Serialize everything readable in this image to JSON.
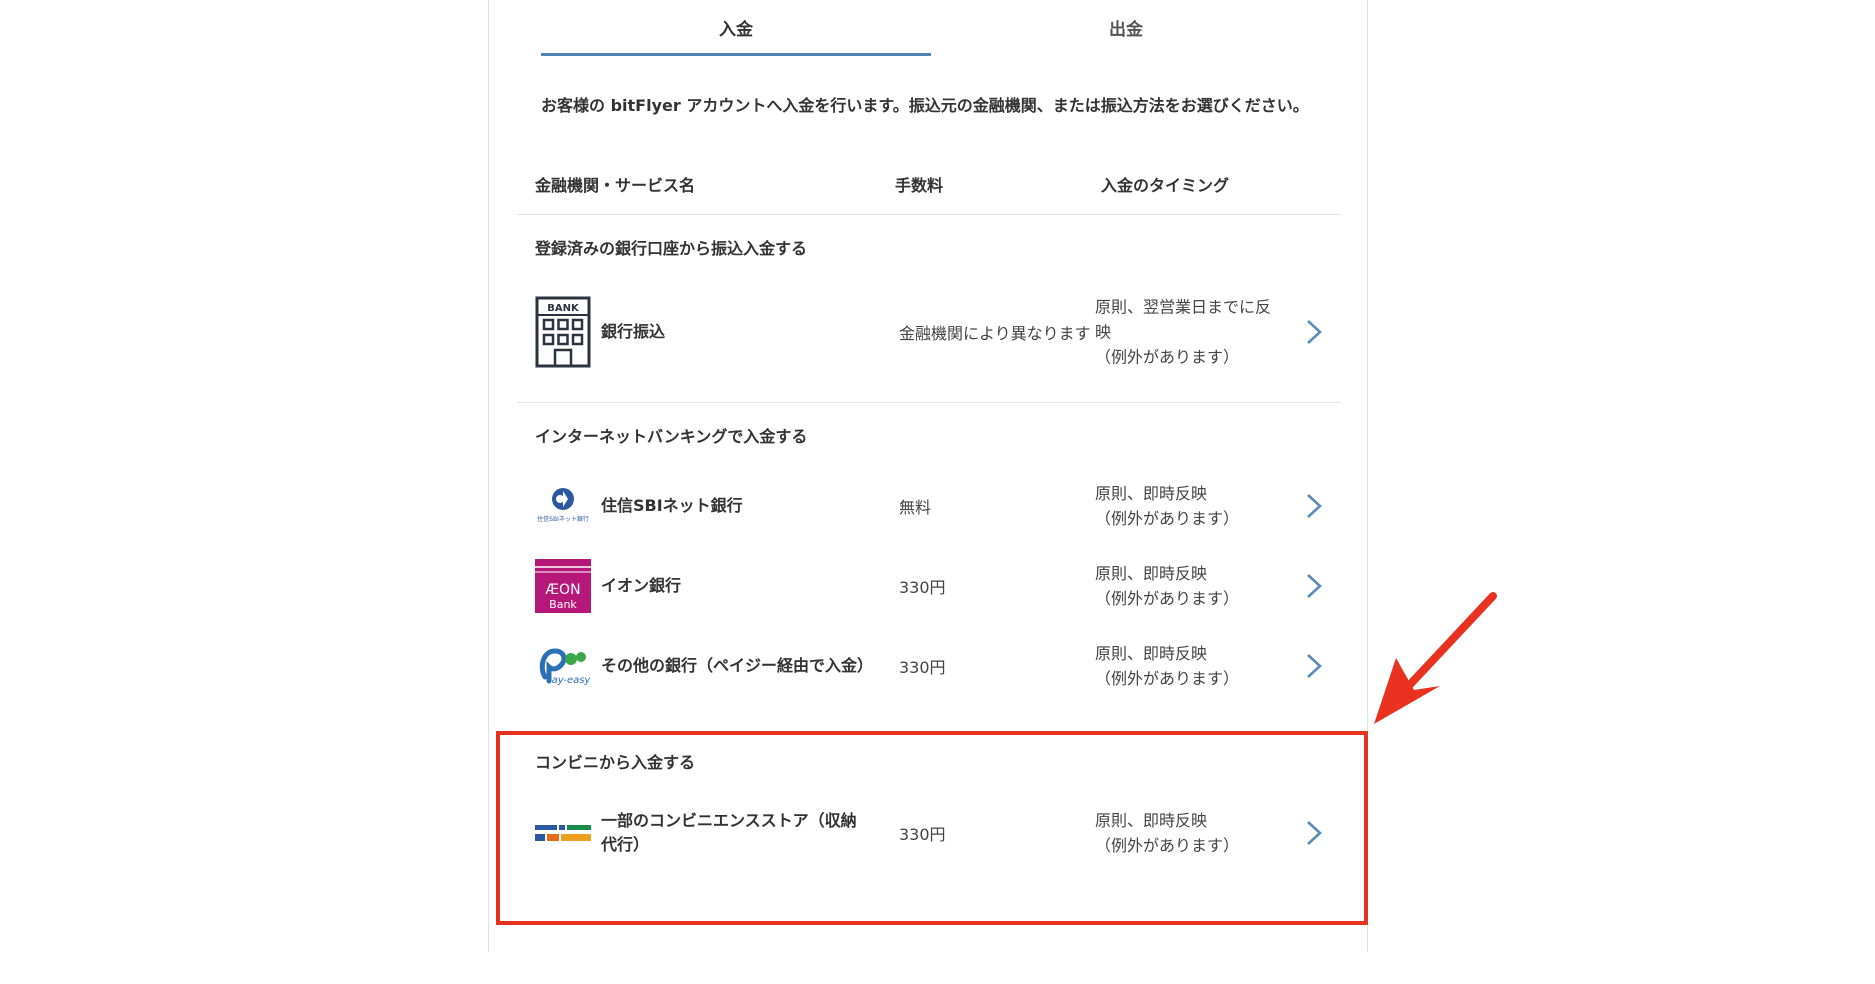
{
  "tabs": [
    {
      "label": "入金",
      "active": true
    },
    {
      "label": "出金",
      "active": false
    }
  ],
  "intro": "お客様の bitFlyer アカウントへ入金を行います。振込元の金融機関、または振込方法をお選びください。",
  "columns": {
    "name": "金融機関・サービス名",
    "fee": "手数料",
    "timing": "入金のタイミング"
  },
  "sections": [
    {
      "title": "登録済みの銀行口座から振込入金する",
      "rows": [
        {
          "name": "銀行振込",
          "fee": "金融機関により異なります",
          "timing": "原則、翌営業日までに反映",
          "note": "（例外があります）",
          "icon": "bank-icon",
          "logo_text": "BANK"
        }
      ]
    },
    {
      "title": "インターネットバンキングで入金する",
      "rows": [
        {
          "name": "住信SBIネット銀行",
          "fee": "無料",
          "timing": "原則、即時反映",
          "note": "（例外があります）",
          "icon": "sbi-bank-logo",
          "logo_text": "住信SBIネット銀行"
        },
        {
          "name": "イオン銀行",
          "fee": "330円",
          "timing": "原則、即時反映",
          "note": "（例外があります）",
          "icon": "aeon-bank-logo",
          "logo_text": "ÆON",
          "logo_sub": "Bank"
        },
        {
          "name": "その他の銀行（ペイジー経由で入金）",
          "fee": "330円",
          "timing": "原則、即時反映",
          "note": "（例外があります）",
          "icon": "payeasy-logo",
          "logo_text": "ay-easy"
        }
      ]
    },
    {
      "title": "コンビニから入金する",
      "rows": [
        {
          "name": "一部のコンビニエンスストア（収納代行）",
          "fee": "330円",
          "timing": "原則、即時反映",
          "note": "（例外があります）",
          "icon": "convenience-store-logo"
        }
      ]
    }
  ],
  "colors": {
    "accent": "#4f82ae",
    "chevron": "#5a8bb8",
    "highlight": "#e8321f",
    "aeon": "#b6187a"
  }
}
